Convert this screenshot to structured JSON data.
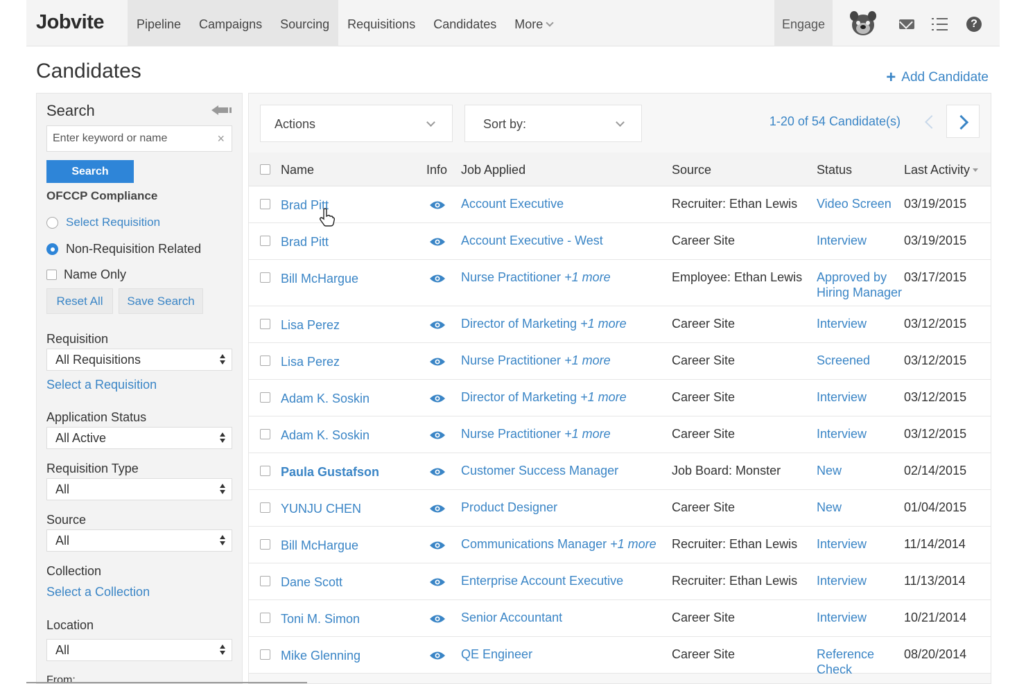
{
  "nav": {
    "logo": "Jobvite",
    "items": [
      "Pipeline",
      "Campaigns",
      "Sourcing",
      "Requisitions",
      "Candidates",
      "More"
    ],
    "engage": "Engage"
  },
  "page": {
    "title": "Candidates",
    "add_candidate": "Add Candidate"
  },
  "sidebar": {
    "title": "Search",
    "search_placeholder": "Enter keyword or name",
    "search_button": "Search",
    "ofccp_label": "OFCCP Compliance",
    "select_requisition_radio": "Select Requisition",
    "non_requisition_radio": "Non-Requisition Related",
    "name_only": "Name Only",
    "reset_all": "Reset All",
    "save_search": "Save Search",
    "requisition_label": "Requisition",
    "requisition_value": "All Requisitions",
    "select_a_requisition": "Select a Requisition",
    "app_status_label": "Application Status",
    "app_status_value": "All Active",
    "req_type_label": "Requisition Type",
    "req_type_value": "All",
    "source_label": "Source",
    "source_value": "All",
    "collection_label": "Collection",
    "select_a_collection": "Select a Collection",
    "location_label": "Location",
    "location_value": "All",
    "from_label": "From:"
  },
  "toolbar": {
    "actions": "Actions",
    "sort_by": "Sort by:",
    "pagination": "1-20 of 54 Candidate(s)"
  },
  "table": {
    "headers": {
      "name": "Name",
      "info": "Info",
      "job": "Job Applied",
      "source": "Source",
      "status": "Status",
      "last_activity": "Last Activity"
    },
    "rows": [
      {
        "name": "Brad Pitt",
        "job": "Account Executive",
        "more": "",
        "source": "Recruiter: Ethan Lewis",
        "status": "Video Screen",
        "date": "03/19/2015"
      },
      {
        "name": "Brad Pitt",
        "job": "Account Executive - West",
        "more": "",
        "source": "Career Site",
        "status": "Interview",
        "date": "03/19/2015"
      },
      {
        "name": "Bill McHargue",
        "job": "Nurse Practitioner",
        "more": "+1 more",
        "source": "Employee: Ethan Lewis",
        "status": "Approved by Hiring Manager",
        "date": "03/17/2015"
      },
      {
        "name": "Lisa Perez",
        "job": "Director of Marketing",
        "more": "+1 more",
        "source": "Career Site",
        "status": "Interview",
        "date": "03/12/2015"
      },
      {
        "name": "Lisa Perez",
        "job": "Nurse Practitioner",
        "more": "+1 more",
        "source": "Career Site",
        "status": "Screened",
        "date": "03/12/2015"
      },
      {
        "name": "Adam K. Soskin",
        "job": "Director of Marketing",
        "more": "+1 more",
        "source": "Career Site",
        "status": "Interview",
        "date": "03/12/2015"
      },
      {
        "name": "Adam K. Soskin",
        "job": "Nurse Practitioner",
        "more": "+1 more",
        "source": "Career Site",
        "status": "Interview",
        "date": "03/12/2015"
      },
      {
        "name": "Paula Gustafson",
        "job": "Customer Success Manager",
        "more": "",
        "source": "Job Board: Monster",
        "status": "New",
        "date": "02/14/2015"
      },
      {
        "name": "YUNJU CHEN",
        "job": "Product Designer",
        "more": "",
        "source": "Career Site",
        "status": "New",
        "date": "01/04/2015"
      },
      {
        "name": "Bill McHargue",
        "job": "Communications Manager",
        "more": "+1 more",
        "source": "Recruiter: Ethan Lewis",
        "status": "Interview",
        "date": "11/14/2014"
      },
      {
        "name": "Dane Scott",
        "job": "Enterprise Account Executive",
        "more": "",
        "source": "Recruiter: Ethan Lewis",
        "status": "Interview",
        "date": "11/13/2014"
      },
      {
        "name": "Toni M. Simon",
        "job": "Senior Accountant",
        "more": "",
        "source": "Career Site",
        "status": "Interview",
        "date": "10/21/2014"
      },
      {
        "name": "Mike Glenning",
        "job": "QE Engineer",
        "more": "",
        "source": "Career Site",
        "status": "Reference Check",
        "date": "08/20/2014"
      }
    ]
  },
  "colors": {
    "accent": "#3a85c6",
    "button": "#2e85d8",
    "nav_bg": "#f4f4f4"
  }
}
